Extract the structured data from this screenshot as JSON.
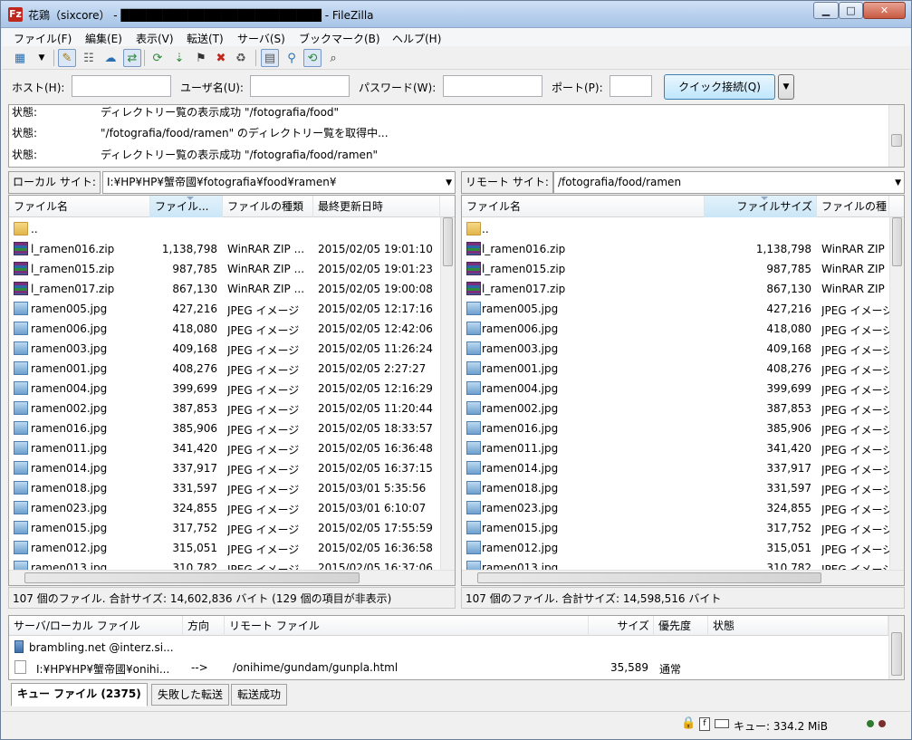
{
  "window": {
    "app_icon": "Fz",
    "title": "花鶏（sixcore） - ████████████████████████ - FileZilla",
    "controls": {
      "minimize": "▁",
      "maximize": "□",
      "close": "✕"
    }
  },
  "menu": [
    "ファイル(F)",
    "編集(E)",
    "表示(V)",
    "転送(T)",
    "サーバ(S)",
    "ブックマーク(B)",
    "ヘルプ(H)"
  ],
  "toolbar": {
    "icons": [
      "site-manager-icon",
      "dropdown-arrow-icon",
      "toggle-log-icon",
      "toggle-tree-icon",
      "toggle-remote-tree-icon",
      "toggle-queue-icon",
      "refresh-icon",
      "process-queue-icon",
      "cancel-icon",
      "disconnect-icon",
      "reconnect-icon",
      "filter-icon",
      "compare-icon",
      "sync-browse-icon",
      "search-icon"
    ]
  },
  "quickconnect": {
    "host_label": "ホスト(H):",
    "user_label": "ユーザ名(U):",
    "pass_label": "パスワード(W):",
    "port_label": "ポート(P):",
    "host_value": "",
    "user_value": "",
    "pass_value": "",
    "port_value": "",
    "connect_label": "クイック接続(Q)",
    "dropdown_glyph": "▼"
  },
  "log": [
    {
      "label": "状態:",
      "text": "ディレクトリー覧の表示成功 \"/fotografia/food\""
    },
    {
      "label": "状態:",
      "text": "\"/fotografia/food/ramen\" のディレクトリー覧を取得中..."
    },
    {
      "label": "状態:",
      "text": "ディレクトリー覧の表示成功 \"/fotografia/food/ramen\""
    }
  ],
  "local": {
    "site_label": "ローカル サイト:",
    "path": "I:¥HP¥HP¥蟹帝國¥fotografia¥food¥ramen¥",
    "headers": [
      "ファイル名",
      "ファイル...",
      "ファイルの種類",
      "最終更新日時"
    ],
    "files": [
      {
        "name": "..",
        "size": "",
        "type": "",
        "date": "",
        "icon": "folder"
      },
      {
        "name": "l_ramen016.zip",
        "size": "1,138,798",
        "type": "WinRAR ZIP ...",
        "date": "2015/02/05 19:01:10",
        "icon": "zip"
      },
      {
        "name": "l_ramen015.zip",
        "size": "987,785",
        "type": "WinRAR ZIP ...",
        "date": "2015/02/05 19:01:23",
        "icon": "zip"
      },
      {
        "name": "l_ramen017.zip",
        "size": "867,130",
        "type": "WinRAR ZIP ...",
        "date": "2015/02/05 19:00:08",
        "icon": "zip"
      },
      {
        "name": "ramen005.jpg",
        "size": "427,216",
        "type": "JPEG イメージ",
        "date": "2015/02/05 12:17:16",
        "icon": "jpg"
      },
      {
        "name": "ramen006.jpg",
        "size": "418,080",
        "type": "JPEG イメージ",
        "date": "2015/02/05 12:42:06",
        "icon": "jpg"
      },
      {
        "name": "ramen003.jpg",
        "size": "409,168",
        "type": "JPEG イメージ",
        "date": "2015/02/05 11:26:24",
        "icon": "jpg"
      },
      {
        "name": "ramen001.jpg",
        "size": "408,276",
        "type": "JPEG イメージ",
        "date": "2015/02/05 2:27:27",
        "icon": "jpg"
      },
      {
        "name": "ramen004.jpg",
        "size": "399,699",
        "type": "JPEG イメージ",
        "date": "2015/02/05 12:16:29",
        "icon": "jpg"
      },
      {
        "name": "ramen002.jpg",
        "size": "387,853",
        "type": "JPEG イメージ",
        "date": "2015/02/05 11:20:44",
        "icon": "jpg"
      },
      {
        "name": "ramen016.jpg",
        "size": "385,906",
        "type": "JPEG イメージ",
        "date": "2015/02/05 18:33:57",
        "icon": "jpg"
      },
      {
        "name": "ramen011.jpg",
        "size": "341,420",
        "type": "JPEG イメージ",
        "date": "2015/02/05 16:36:48",
        "icon": "jpg"
      },
      {
        "name": "ramen014.jpg",
        "size": "337,917",
        "type": "JPEG イメージ",
        "date": "2015/02/05 16:37:15",
        "icon": "jpg"
      },
      {
        "name": "ramen018.jpg",
        "size": "331,597",
        "type": "JPEG イメージ",
        "date": "2015/03/01 5:35:56",
        "icon": "jpg"
      },
      {
        "name": "ramen023.jpg",
        "size": "324,855",
        "type": "JPEG イメージ",
        "date": "2015/03/01 6:10:07",
        "icon": "jpg"
      },
      {
        "name": "ramen015.jpg",
        "size": "317,752",
        "type": "JPEG イメージ",
        "date": "2015/02/05 17:55:59",
        "icon": "jpg"
      },
      {
        "name": "ramen012.jpg",
        "size": "315,051",
        "type": "JPEG イメージ",
        "date": "2015/02/05 16:36:58",
        "icon": "jpg"
      },
      {
        "name": "ramen013.jpg",
        "size": "310,782",
        "type": "JPEG イメージ",
        "date": "2015/02/05 16:37:06",
        "icon": "jpg"
      }
    ],
    "status": "107 個のファイル. 合計サイズ: 14,602,836 バイト (129 個の項目が非表示)"
  },
  "remote": {
    "site_label": "リモート サイト:",
    "path": "/fotografia/food/ramen",
    "headers": [
      "ファイル名",
      "ファイルサイズ",
      "ファイルの種"
    ],
    "files": [
      {
        "name": "..",
        "size": "",
        "type": "",
        "icon": "folder"
      },
      {
        "name": "l_ramen016.zip",
        "size": "1,138,798",
        "type": "WinRAR ZIP",
        "icon": "zip"
      },
      {
        "name": "l_ramen015.zip",
        "size": "987,785",
        "type": "WinRAR ZIP",
        "icon": "zip"
      },
      {
        "name": "l_ramen017.zip",
        "size": "867,130",
        "type": "WinRAR ZIP",
        "icon": "zip"
      },
      {
        "name": "ramen005.jpg",
        "size": "427,216",
        "type": "JPEG イメージ",
        "icon": "jpg"
      },
      {
        "name": "ramen006.jpg",
        "size": "418,080",
        "type": "JPEG イメージ",
        "icon": "jpg"
      },
      {
        "name": "ramen003.jpg",
        "size": "409,168",
        "type": "JPEG イメージ",
        "icon": "jpg"
      },
      {
        "name": "ramen001.jpg",
        "size": "408,276",
        "type": "JPEG イメージ",
        "icon": "jpg"
      },
      {
        "name": "ramen004.jpg",
        "size": "399,699",
        "type": "JPEG イメージ",
        "icon": "jpg"
      },
      {
        "name": "ramen002.jpg",
        "size": "387,853",
        "type": "JPEG イメージ",
        "icon": "jpg"
      },
      {
        "name": "ramen016.jpg",
        "size": "385,906",
        "type": "JPEG イメージ",
        "icon": "jpg"
      },
      {
        "name": "ramen011.jpg",
        "size": "341,420",
        "type": "JPEG イメージ",
        "icon": "jpg"
      },
      {
        "name": "ramen014.jpg",
        "size": "337,917",
        "type": "JPEG イメージ",
        "icon": "jpg"
      },
      {
        "name": "ramen018.jpg",
        "size": "331,597",
        "type": "JPEG イメージ",
        "icon": "jpg"
      },
      {
        "name": "ramen023.jpg",
        "size": "324,855",
        "type": "JPEG イメージ",
        "icon": "jpg"
      },
      {
        "name": "ramen015.jpg",
        "size": "317,752",
        "type": "JPEG イメージ",
        "icon": "jpg"
      },
      {
        "name": "ramen012.jpg",
        "size": "315,051",
        "type": "JPEG イメージ",
        "icon": "jpg"
      },
      {
        "name": "ramen013.jpg",
        "size": "310,782",
        "type": "JPEG イメージ",
        "icon": "jpg"
      }
    ],
    "status": "107 個のファイル. 合計サイズ: 14,598,516 バイト"
  },
  "queue": {
    "headers": [
      "サーバ/ローカル ファイル",
      "方向",
      "リモート ファイル",
      "サイズ",
      "優先度",
      "状態"
    ],
    "server": "brambling.net @interz.si...",
    "item": {
      "local": "I:¥HP¥HP¥蟹帝國¥onihi...",
      "direction": "-->",
      "remote": "/onihime/gundam/gunpla.html",
      "size": "35,589",
      "priority": "通常",
      "state": ""
    }
  },
  "tabs": [
    "キュー ファイル (2375)",
    "失敗した転送",
    "転送成功"
  ],
  "statusbar": {
    "lock": "🔒",
    "queue_text": "キュー: 334.2 MiB"
  },
  "colors": {
    "accent": "#3c7fb1",
    "close": "#c85a41",
    "led_green": "#2f7a2f",
    "led_red": "#7a2f2f"
  }
}
